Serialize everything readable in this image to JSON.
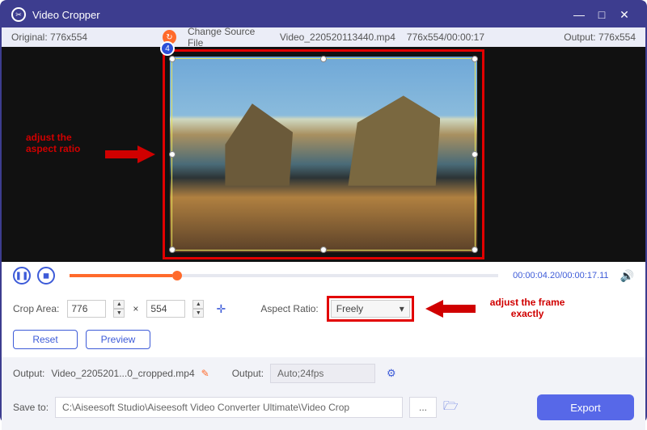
{
  "titlebar": {
    "title": "Video Cropper"
  },
  "infobar": {
    "original": "Original: 776x554",
    "change_source": "Change Source File",
    "filename": "Video_220520113440.mp4",
    "dims_dur": "776x554/00:00:17",
    "output": "Output: 776x554"
  },
  "badge": "4",
  "annotations": {
    "a1_l1": "adjust the",
    "a1_l2": "aspect ratio",
    "a2_l1": "adjust the frame",
    "a2_l2": "exactly"
  },
  "playback": {
    "time": "00:00:04.20/00:00:17.11"
  },
  "params": {
    "crop_area_label": "Crop Area:",
    "w": "776",
    "h": "554",
    "times": "×",
    "aspect_label": "Aspect Ratio:",
    "aspect_value": "Freely"
  },
  "buttons": {
    "reset": "Reset",
    "preview": "Preview",
    "export": "Export"
  },
  "output": {
    "label": "Output:",
    "filename": "Video_2205201...0_cropped.mp4",
    "label2": "Output:",
    "fmt": "Auto;24fps"
  },
  "save": {
    "label": "Save to:",
    "path": "C:\\Aiseesoft Studio\\Aiseesoft Video Converter Ultimate\\Video Crop",
    "dots": "..."
  }
}
